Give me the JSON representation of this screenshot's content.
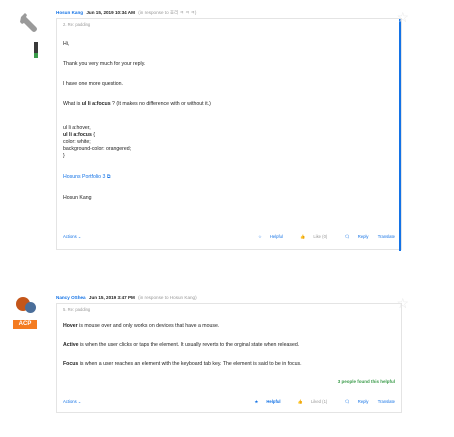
{
  "post1": {
    "author": "Hosun Kang",
    "date": "Jun 15, 2019 10:34 AM",
    "in_response": "(in response to 효리 ㅋ ㅋ ㅋ)",
    "subject": "2. Re: padding",
    "greeting": "Hi,",
    "thanks": "Thank you very much for your reply.",
    "one_more": "I have one more question.",
    "q_prefix": "What is ",
    "q_code": "ul li a:focus",
    "q_suffix": " ? (It makes no difference with or without it.)",
    "code_1": "ul li a:hover,",
    "code_2": "ul li a:focus",
    "code_2_suffix": " {",
    "code_3": "color: white;",
    "code_4": "background-color: orangered;",
    "code_5": "}",
    "portfolio_link": "Hosuns Portfolio 3",
    "signature": "Hosun Kang",
    "actions": "Actions",
    "helpful": "Helpful",
    "like": "Like (0)",
    "reply": "Reply",
    "translate": "Translate"
  },
  "post2": {
    "author": "Nancy OShea",
    "date": "Jun 15, 2019 3:47 PM",
    "in_response": "(in response to Hosun Kang)",
    "badge": "ACP",
    "subject": "5. Re: padding",
    "hover_term": "Hover",
    "hover_text": " is mouse over and only works on devices that have a mouse.",
    "active_term": "Active",
    "active_text": " is when the user clicks or taps the element.  It usually reverts to the orginal state when released.",
    "focus_term": "Focus",
    "focus_text": " is when a user reaches an element with the keyboard tab key. The element is said to be in focus.",
    "found_helpful": "3 people found this helpful",
    "actions": "Actions",
    "helpful": "Helpful",
    "like": "Liked (1)",
    "reply": "Reply",
    "translate": "Translate"
  },
  "colors": {
    "link": "#1473e6",
    "helpful_green": "#3a9b4a",
    "badge_orange": "#f47b20"
  }
}
